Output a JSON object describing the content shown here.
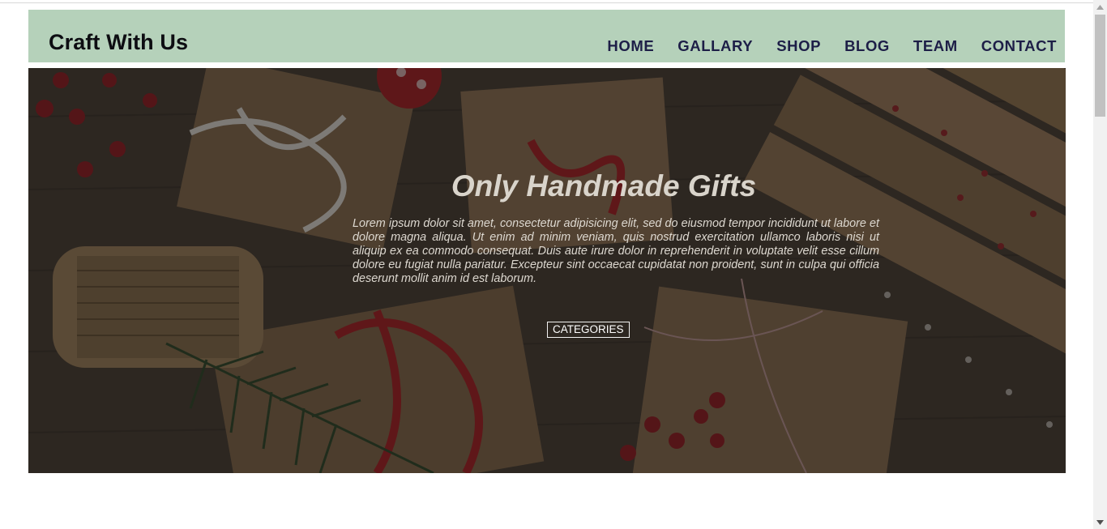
{
  "header": {
    "brand": "Craft With Us",
    "nav": [
      {
        "label": "HOME"
      },
      {
        "label": "GALLARY"
      },
      {
        "label": "SHOP"
      },
      {
        "label": "BLOG"
      },
      {
        "label": "TEAM"
      },
      {
        "label": "CONTACT"
      }
    ],
    "background_color": "#b5d1ba",
    "nav_color": "#1d1e47"
  },
  "hero": {
    "title": "Only Handmade Gifts",
    "text": "Lorem ipsum dolor sit amet, consectetur adipisicing elit, sed do eiusmod tempor incididunt ut labore et dolore magna aliqua. Ut enim ad minim veniam, quis nostrud exercitation ullamco laboris nisi ut aliquip ex ea commodo consequat. Duis aute irure dolor in reprehenderit in voluptate velit esse cillum dolore eu fugiat nulla pariatur. Excepteur sint occaecat cupidatat non proident, sunt in culpa qui officia deserunt mollit anim id est laborum.",
    "button_label": "CATEGORIES",
    "image": "wrapped-gifts-photo"
  },
  "scrollbar": {
    "up_icon": "scroll-up-arrow-icon",
    "down_icon": "scroll-down-arrow-icon"
  }
}
